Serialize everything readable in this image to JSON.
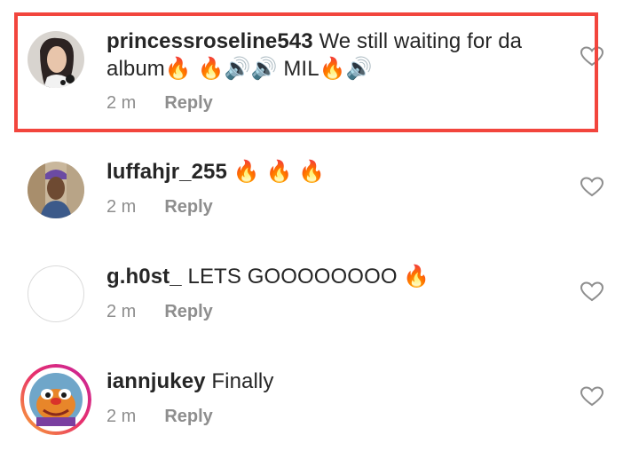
{
  "comments": [
    {
      "username": "princessroseline543",
      "text": " We still waiting for da",
      "text_line2": "album🔥 🔥🔊🔊 MIL🔥🔊",
      "time": "2 m",
      "reply": "Reply"
    },
    {
      "username": "luffahjr_255",
      "text": " 🔥 🔥 🔥",
      "time": "2 m",
      "reply": "Reply"
    },
    {
      "username": "g.h0st_",
      "text": " LETS GOOOOOOOO 🔥",
      "time": "2 m",
      "reply": "Reply"
    },
    {
      "username": "iannjukey",
      "text": " Finally",
      "time": "2 m",
      "reply": "Reply"
    }
  ],
  "colors": {
    "highlight": "#f2453d",
    "meta": "#8e8e8e",
    "text": "#262626"
  }
}
